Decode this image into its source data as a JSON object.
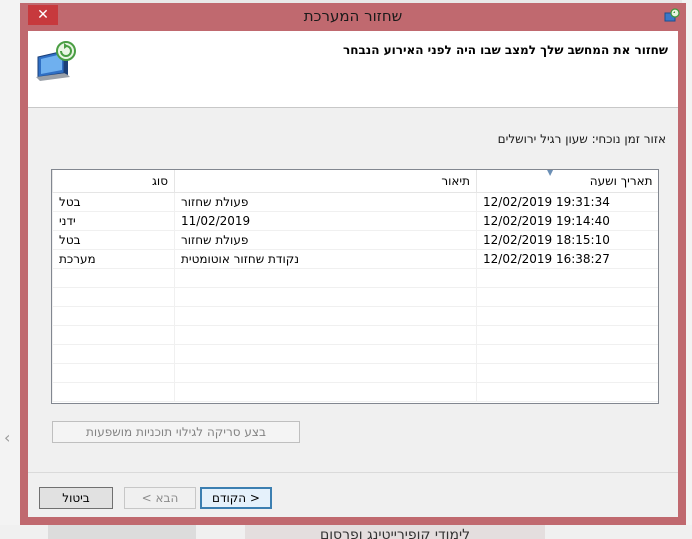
{
  "dialog": {
    "title": "שחזור המערכת",
    "close_symbol": "✕",
    "header_title": "שחזור את המחשב שלך למצב שבו היה לפני האירוע הנבחר",
    "timezone_label": "אזור זמן נוכחי: שעון רגיל ירושלים"
  },
  "table": {
    "columns": [
      "תאריך ושעה",
      "תיאור",
      "סוג"
    ],
    "rows": [
      {
        "date": "12/02/2019 19:31:34",
        "desc": "פעולת שחזור",
        "type": "בטל"
      },
      {
        "date": "12/02/2019 19:14:40",
        "desc": "11/02/2019",
        "type": "ידני"
      },
      {
        "date": "12/02/2019 18:15:10",
        "desc": "פעולת שחזור",
        "type": "בטל"
      },
      {
        "date": "12/02/2019 16:38:27",
        "desc": "נקודת שחזור אוטומטית",
        "type": "מערכת"
      }
    ]
  },
  "buttons": {
    "scan": "בצע סריקה לגילוי תוכניות מושפעות",
    "back": "< הקודם",
    "next": "הבא >",
    "cancel": "ביטול"
  },
  "background": {
    "bottom_text": "לימודי קופירייטינג ופרסום"
  },
  "colors": {
    "frame": "#c0696f",
    "close": "#c7393d",
    "focus": "#3c7fb1"
  }
}
